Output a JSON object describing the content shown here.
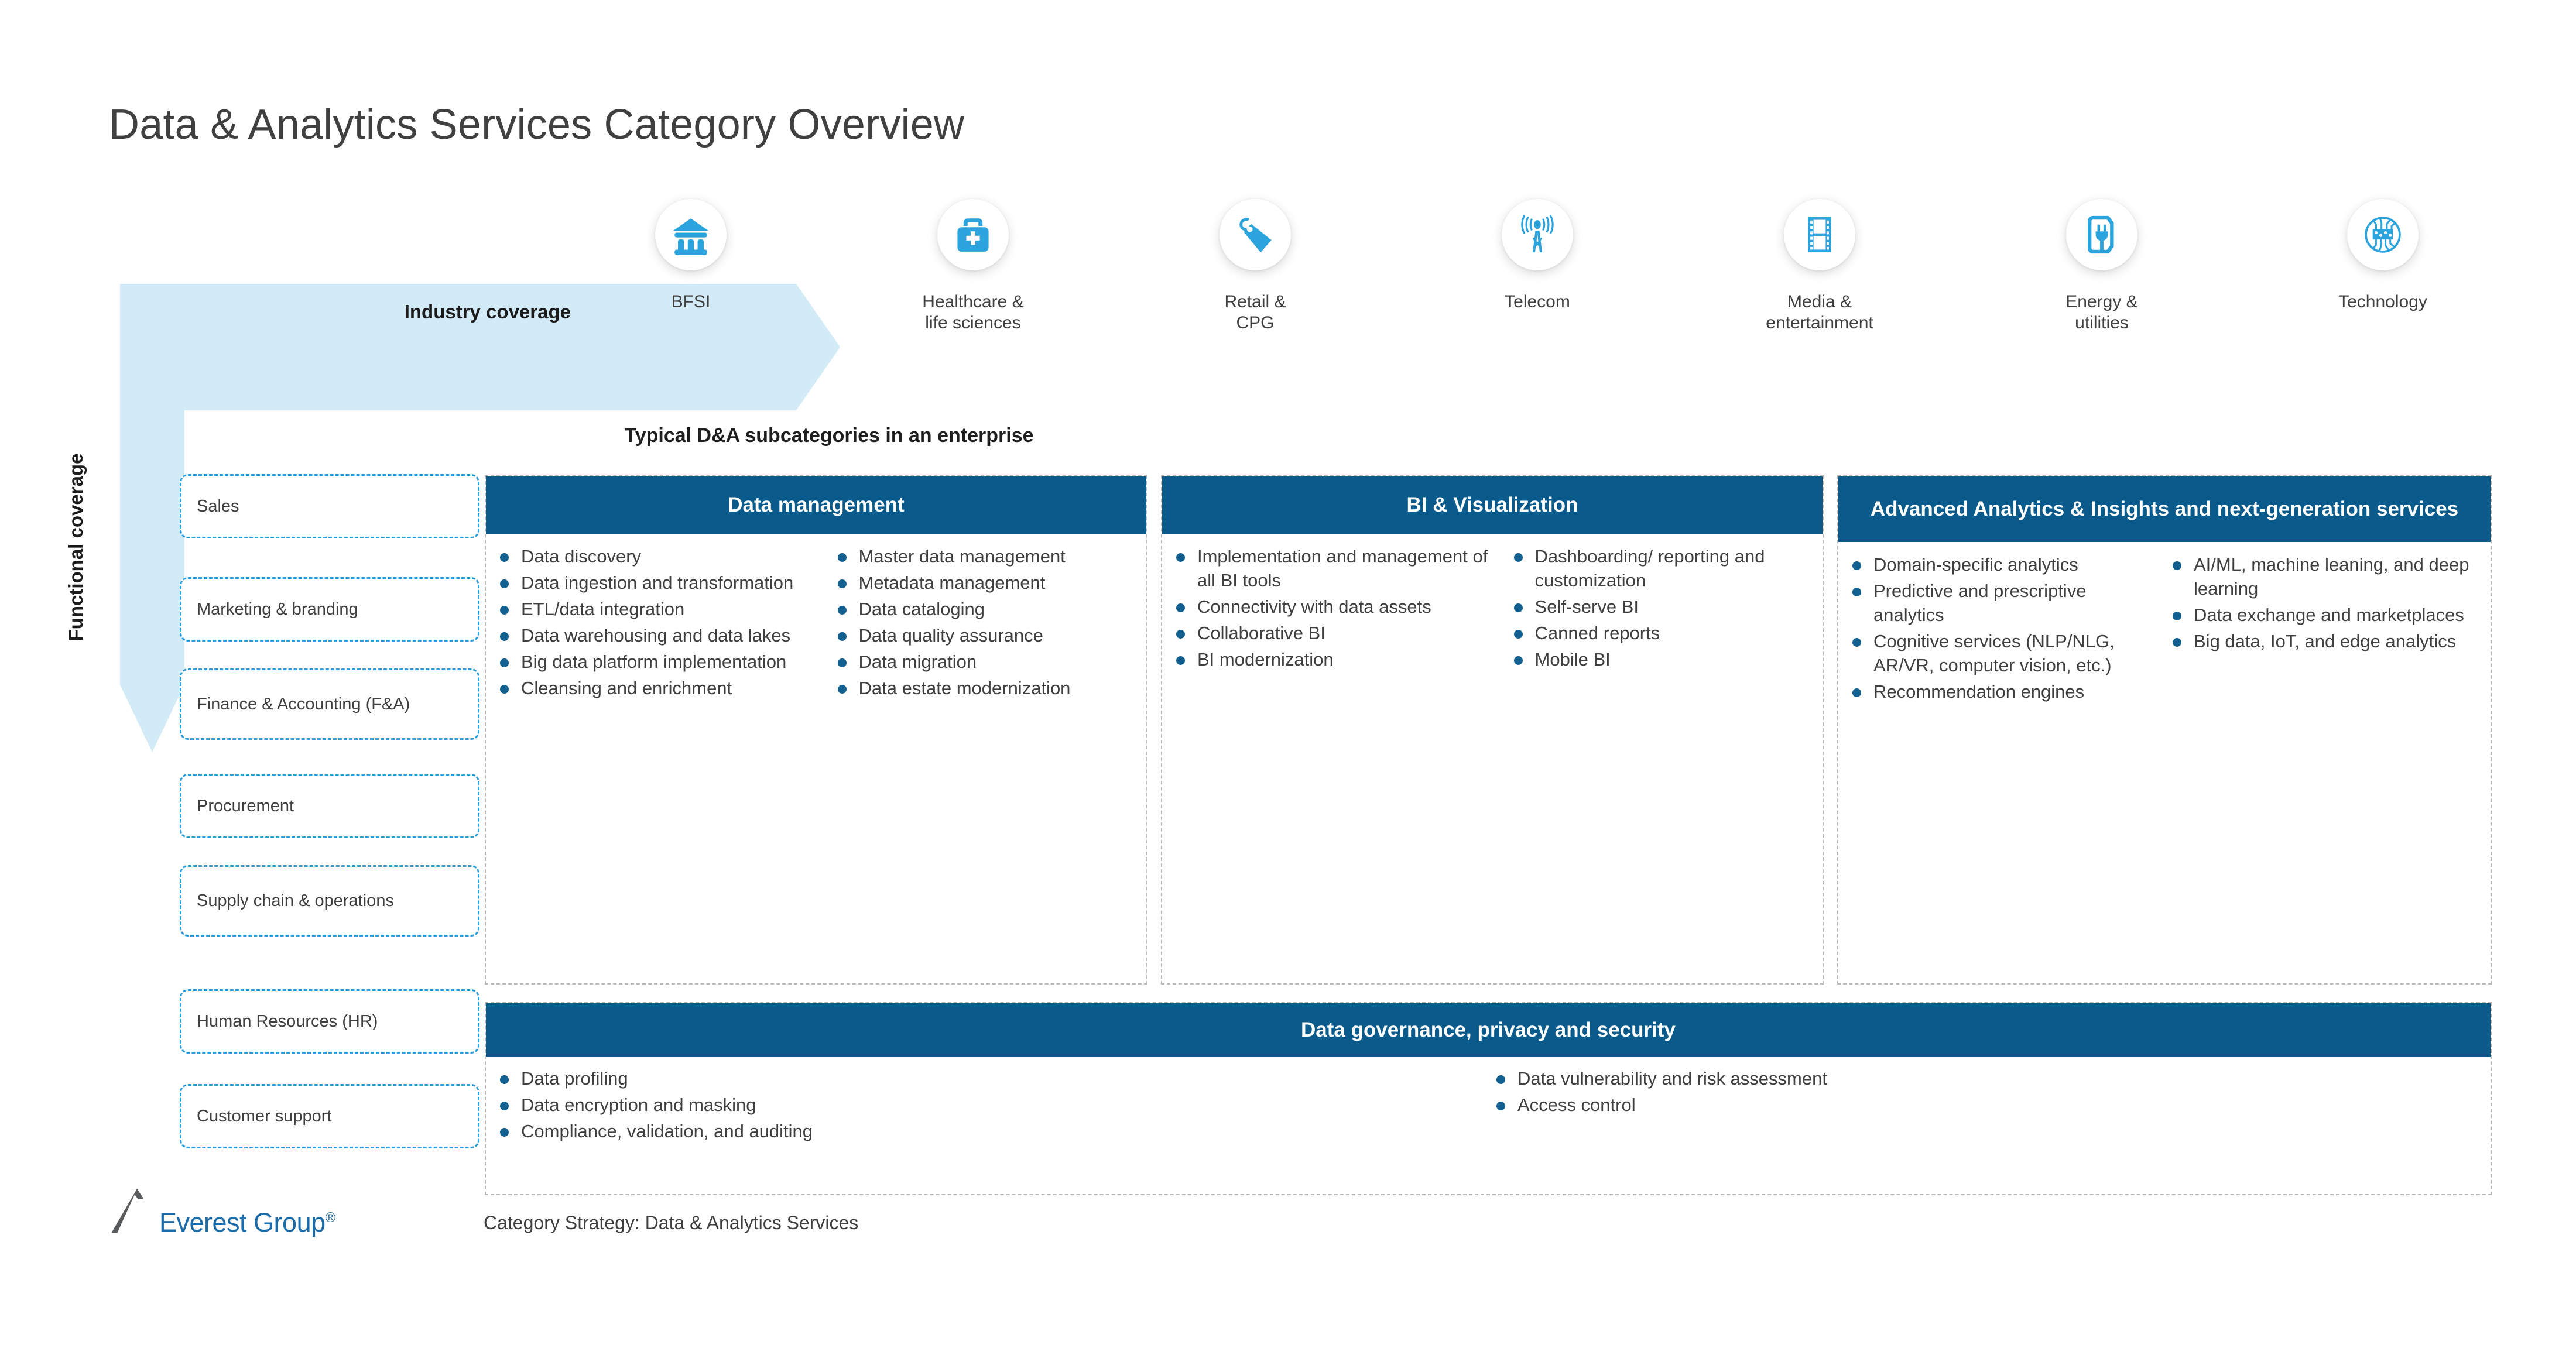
{
  "title": "Data & Analytics Services Category Overview",
  "axes": {
    "industry_label": "Industry coverage",
    "functional_label": "Functional coverage"
  },
  "subcategories_heading": "Typical D&A subcategories in an enterprise",
  "industries": [
    {
      "label": "BFSI",
      "icon": "bank-icon"
    },
    {
      "label": "Healthcare &\nlife sciences",
      "icon": "medical-briefcase-icon"
    },
    {
      "label": "Retail &\nCPG",
      "icon": "price-tag-icon"
    },
    {
      "label": "Telecom",
      "icon": "broadcast-tower-icon"
    },
    {
      "label": "Media &\nentertainment",
      "icon": "filmstrip-icon"
    },
    {
      "label": "Energy &\nutilities",
      "icon": "power-plug-icon"
    },
    {
      "label": "Technology",
      "icon": "circuit-chip-icon"
    }
  ],
  "functions": [
    "Sales",
    "Marketing & branding",
    "Finance & Accounting (F&A)",
    "Procurement",
    "Supply chain & operations",
    "Human Resources (HR)",
    "Customer support"
  ],
  "categories": [
    {
      "title": "Data management",
      "col1": [
        "Data discovery",
        "Data ingestion and transformation",
        "ETL/data integration",
        "Data warehousing and data lakes",
        "Big data platform implementation",
        "Cleansing and enrichment"
      ],
      "col2": [
        "Master data management",
        "Metadata management",
        "Data cataloging",
        "Data quality assurance",
        "Data migration",
        "Data estate modernization"
      ]
    },
    {
      "title": "BI & Visualization",
      "col1": [
        "Implementation and management of all BI tools",
        "Connectivity with data assets",
        "Collaborative BI",
        "BI modernization"
      ],
      "col2": [
        "Dashboarding/ reporting and customization",
        "Self-serve BI",
        "Canned reports",
        "Mobile BI"
      ]
    },
    {
      "title": "Advanced Analytics & Insights and next-generation services",
      "col1": [
        "Domain-specific analytics",
        "Predictive and prescriptive analytics",
        "Cognitive services (NLP/NLG, AR/VR, computer vision, etc.)",
        "Recommendation engines"
      ],
      "col2": [
        "AI/ML, machine leaning, and deep learning",
        "Data exchange and marketplaces",
        "Big data, IoT, and edge analytics"
      ]
    }
  ],
  "governance": {
    "title": "Data governance, privacy and security",
    "col1": [
      "Data profiling",
      "Data encryption and masking",
      "Compliance, validation, and auditing"
    ],
    "col2": [
      "Data vulnerability and risk assessment",
      "Access control"
    ]
  },
  "footer": {
    "brand": "Everest Group",
    "registered": "®",
    "caption": "Category Strategy: Data & Analytics Services"
  },
  "colors": {
    "header_blue": "#0a5b8c",
    "icon_blue": "#2ba3dd",
    "arrow_blue": "#d3eaf7",
    "dashed_blue": "#2b9cd8",
    "panel_border": "#b8b8b8",
    "text": "#3f3f3f"
  }
}
